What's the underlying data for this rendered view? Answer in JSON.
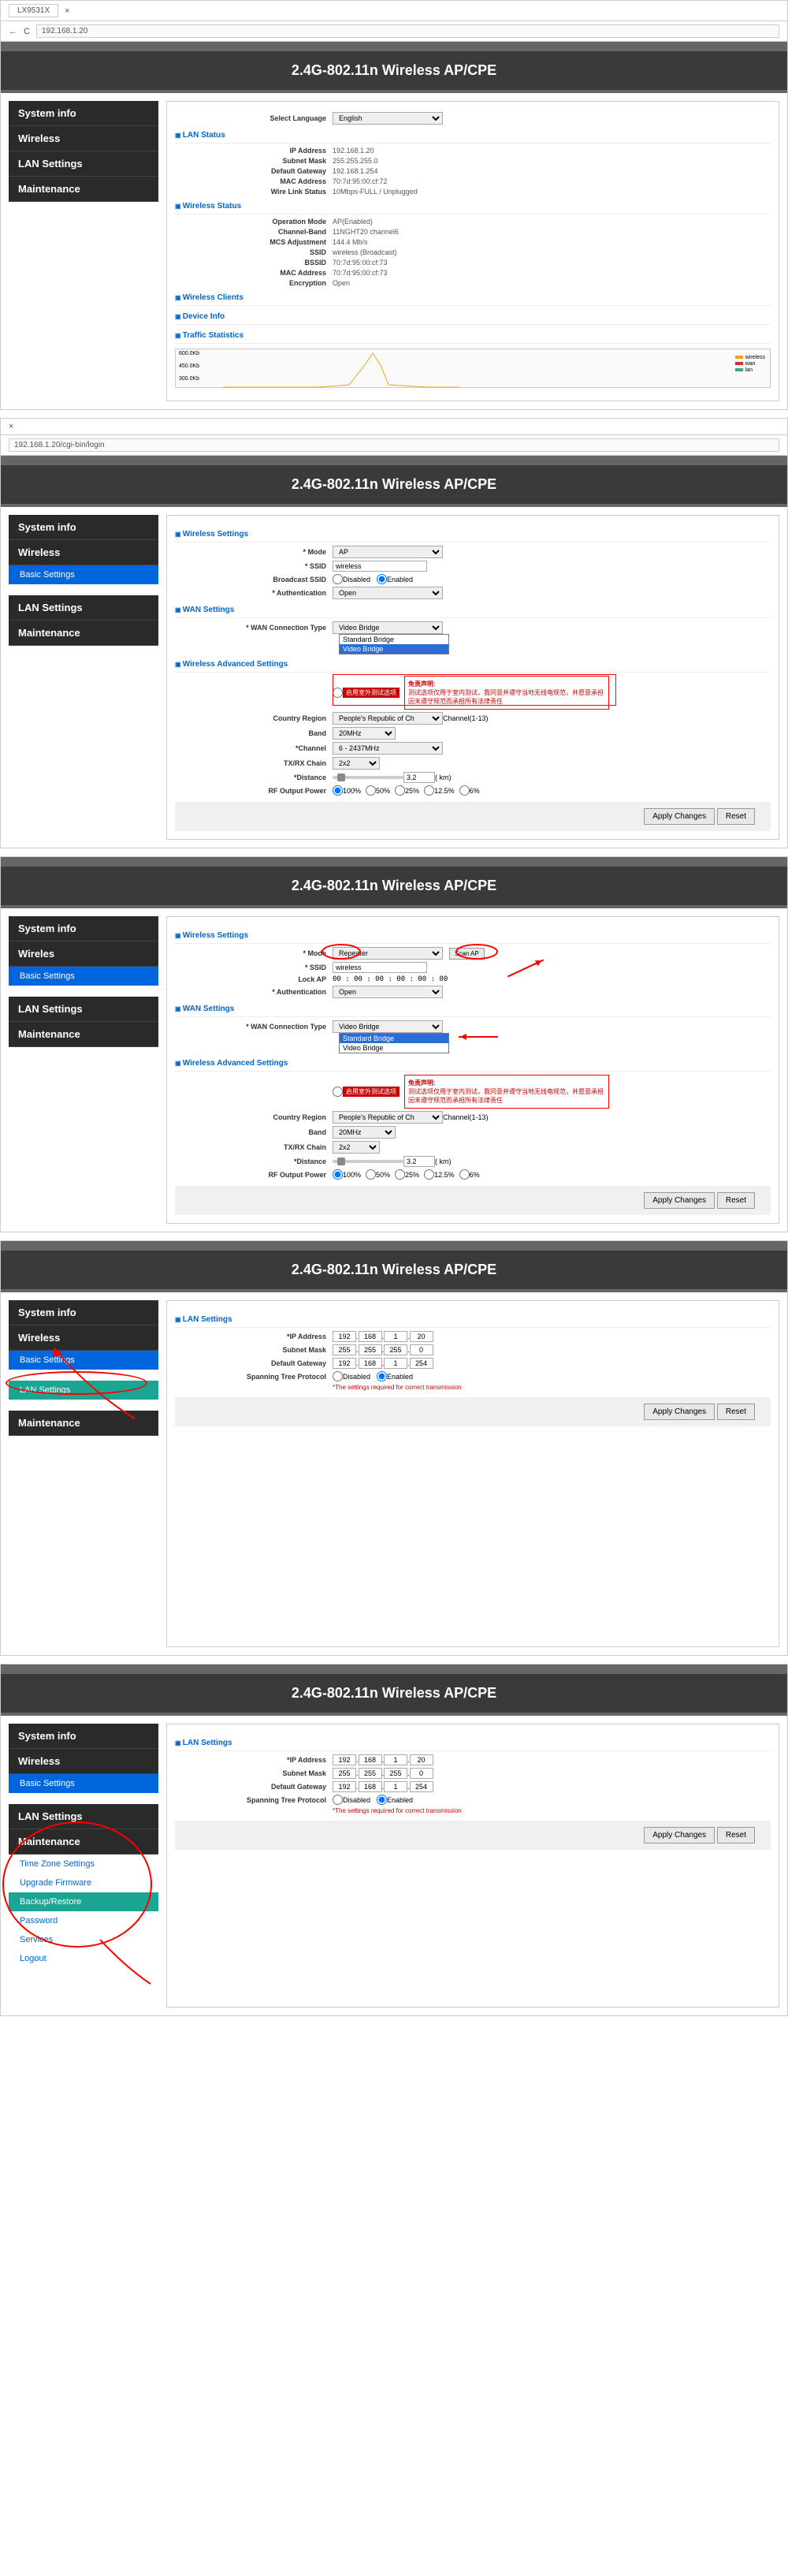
{
  "browser": {
    "tab": "LX9531X",
    "url1": "192.168.1.20",
    "url2": "192.168.1.20/cgi-bin/login"
  },
  "title": "2.4G-802.11n Wireless AP/CPE",
  "nav": {
    "system": "System info",
    "wireless": "Wireless",
    "wireless_alt": "Wireles",
    "basic": "Basic Settings",
    "lan": "LAN Settings",
    "maint": "Maintenance"
  },
  "maint_sub": {
    "tz": "Time Zone Settings",
    "fw": "Upgrade Firmware",
    "cfg": "Backup/Restore",
    "pw": "Password",
    "svc": "Services",
    "logout": "Logout"
  },
  "p1": {
    "lang_label": "Select Language",
    "lang": "English",
    "sec1": "LAN Status",
    "ip_l": "IP Address",
    "ip": "192.168.1.20",
    "mask_l": "Subnet Mask",
    "mask": "255.255.255.0",
    "gw_l": "Default Gateway",
    "gw": "192.168.1.254",
    "mac_l": "MAC Address",
    "mac": "70:7d:95:00:cf:72",
    "link_l": "Wire Link Status",
    "link": "10Mbps-FULL / Unplugged",
    "sec2": "Wireless Status",
    "mode_l": "Operation Mode",
    "mode": "AP(Enabled)",
    "band_l": "Channel-Band",
    "band": "11NGHT20   channel6",
    "mcs_l": "MCS Adjustment",
    "mcs": "144.4 Mb/s",
    "ssid_l": "SSID",
    "ssid": "wireless  (Broadcast)",
    "bssid_l": "BSSID",
    "bssid": "70:7d:95:00:cf:73",
    "mac2_l": "MAC Address",
    "mac2": "70:7d:95:00:cf:73",
    "enc_l": "Encryption",
    "enc": "Open",
    "sec3": "Wireless Clients",
    "sec4": "Device Info",
    "sec5": "Traffic Statistics",
    "y1": "600.0Kb",
    "y2": "450.0Kb",
    "y3": "300.0Kb",
    "lg1": "wireless",
    "lg2": "wan",
    "lg3": "lan"
  },
  "p2": {
    "sec1": "Wireless Settings",
    "mode_l": "* Mode",
    "mode": "AP",
    "ssid_l": "* SSID",
    "ssid": "wireless",
    "bcast_l": "Broadcast SSID",
    "disabled": "Disabled",
    "enabled": "Enabled",
    "auth_l": "* Authentication",
    "auth": "Open",
    "sec2": "WAN Settings",
    "conn_l": "* WAN Connection Type",
    "conn": "Video Bridge",
    "opt1": "Standard Bridge",
    "opt2": "Video Bridge",
    "sec3": "Wireless Advanced Settings",
    "test_btn": "启用室外测试选项",
    "warn1": "免责声明:",
    "warn2": "测试选项仅用于室内测试，我同意并遵守当地无线电规范，并愿意承担因未遵守规范而承担所有法律责任",
    "region_l": "Country Region",
    "region": "People's Republic of Ch",
    "region_suffix": "Channel(1-13)",
    "band_l": "Band",
    "band": "20MHz",
    "chan_l": "*Channel",
    "chan": "6 - 2437MHz",
    "txrx_l": "TX/RX Chain",
    "txrx": "2x2",
    "dist_l": "*Distance",
    "dist": "3.2",
    "dist_unit": "( km)",
    "pwr_l": "RF Output Power",
    "p100": "100%",
    "p50": "50%",
    "p25": "25%",
    "p12": "12.5%",
    "p6": "6%",
    "apply": "Apply Changes",
    "reset": "Reset"
  },
  "p3": {
    "sec1": "Wireless Settings",
    "mode_l": "* Mode",
    "mode": "Repeater",
    "scan": "Scan AP",
    "ssid_l": "* SSID",
    "ssid": "wireless",
    "lock_l": "Lock AP",
    "lock": "00 : 00 : 00 : 00 : 00 : 00",
    "auth_l": "* Authentication",
    "auth": "Open",
    "sec2": "WAN Settings",
    "conn_l": "* WAN Connection Type",
    "conn": "Video Bridge",
    "opt1": "Standard Bridge",
    "opt2": "Video Bridge",
    "sec3": "Wireless Advanced Settings",
    "region_l": "Country Region",
    "region": "People's Republic of Ch",
    "region_suffix": "Channel(1-13)",
    "band_l": "Band",
    "band": "20MHz",
    "txrx_l": "TX/RX Chain",
    "txrx": "2x2",
    "dist_l": "*Distance",
    "dist": "3.2",
    "dist_unit": "( km)",
    "pwr_l": "RF Output Power",
    "apply": "Apply Changes",
    "reset": "Reset"
  },
  "p4": {
    "sec1": "LAN Settings",
    "ip_l": "*IP Address",
    "ip": [
      "192",
      "168",
      "1",
      "20"
    ],
    "mask_l": "Subnet Mask",
    "mask": [
      "255",
      "255",
      "255",
      "0"
    ],
    "gw_l": "Default Gateway",
    "gw": [
      "192",
      "168",
      "1",
      "254"
    ],
    "stp_l": "Spanning Tree Protocol",
    "disabled": "Disabled",
    "enabled": "Enabled",
    "note": "*The settings required for correct transmission",
    "apply": "Apply Changes",
    "reset": "Reset"
  }
}
